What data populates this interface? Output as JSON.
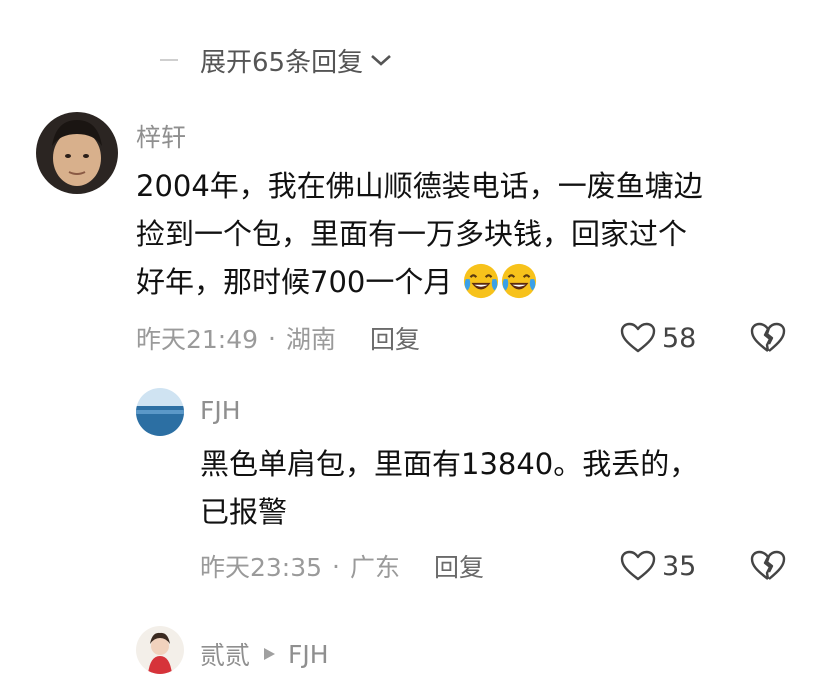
{
  "expand": {
    "label": "展开65条回复"
  },
  "comments": [
    {
      "name": "梓轩",
      "text_line1": "2004年，我在佛山顺德装电话，一废鱼塘边",
      "text_line2": "捡到一个包，里面有一万多块钱，回家过个",
      "text_line3": "好年，那时候700一个月",
      "emoji": "laughing-crying-emoji",
      "time": "昨天21:49",
      "location": "湖南",
      "reply_label": "回复",
      "likes": "58"
    },
    {
      "name": "FJH",
      "text_line1": "黑色单肩包，里面有13840。我丢的，",
      "text_line2": "已报警",
      "time": "昨天23:35",
      "location": "广东",
      "reply_label": "回复",
      "likes": "35"
    },
    {
      "name": "贰贰",
      "reply_to": "FJH"
    }
  ],
  "separator": "·",
  "colors": {
    "muted": "#9a9a9a",
    "text": "#111111",
    "emoji_yellow": "#f7c21b",
    "tear_blue": "#3aa0e8"
  }
}
